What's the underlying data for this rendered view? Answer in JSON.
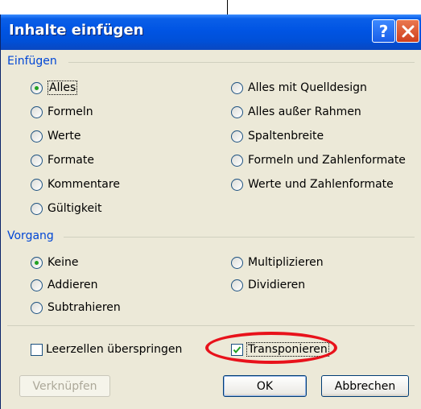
{
  "dialog": {
    "title": "Inhalte einfügen",
    "help_label": "?"
  },
  "einfuegen": {
    "label": "Einfügen",
    "left": [
      {
        "label": "Alles",
        "selected": true
      },
      {
        "label": "Formeln",
        "selected": false
      },
      {
        "label": "Werte",
        "selected": false
      },
      {
        "label": "Formate",
        "selected": false
      },
      {
        "label": "Kommentare",
        "selected": false
      },
      {
        "label": "Gültigkeit",
        "selected": false
      }
    ],
    "right": [
      {
        "label": "Alles mit Quelldesign",
        "selected": false
      },
      {
        "label": "Alles außer Rahmen",
        "selected": false
      },
      {
        "label": "Spaltenbreite",
        "selected": false
      },
      {
        "label": "Formeln und Zahlenformate",
        "selected": false
      },
      {
        "label": "Werte und Zahlenformate",
        "selected": false
      }
    ]
  },
  "vorgang": {
    "label": "Vorgang",
    "left": [
      {
        "label": "Keine",
        "selected": true
      },
      {
        "label": "Addieren",
        "selected": false
      },
      {
        "label": "Subtrahieren",
        "selected": false
      }
    ],
    "right": [
      {
        "label": "Multiplizieren",
        "selected": false
      },
      {
        "label": "Dividieren",
        "selected": false
      }
    ]
  },
  "options": {
    "skip_blanks": {
      "label": "Leerzellen überspringen",
      "checked": false
    },
    "transpose": {
      "label": "Transponieren",
      "checked": true
    }
  },
  "buttons": {
    "link": "Verknüpfen",
    "ok": "OK",
    "cancel": "Abbrechen"
  },
  "colors": {
    "title_bar": "#0054e3",
    "group_label": "#0046d5",
    "highlight": "#e8121b",
    "dialog_bg": "#ece9d8"
  }
}
